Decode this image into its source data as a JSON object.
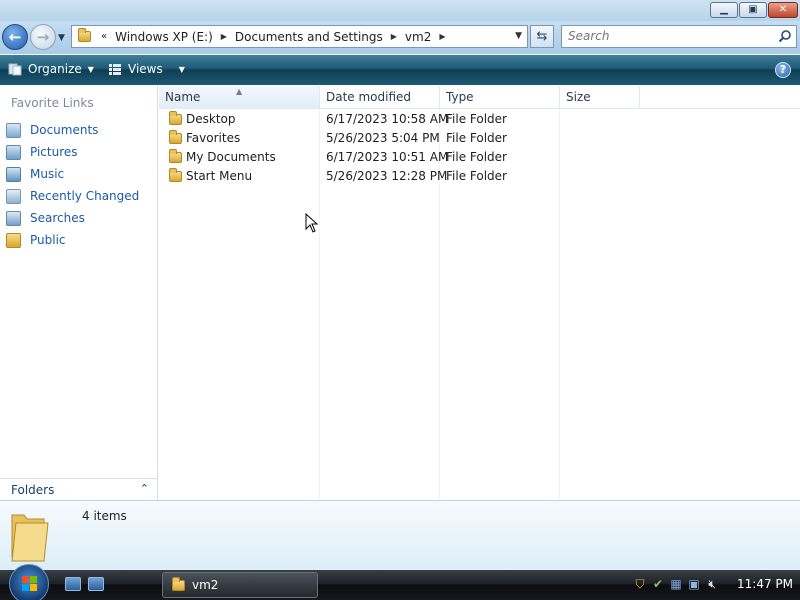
{
  "window": {
    "controls": [
      "minimize",
      "maximize",
      "close"
    ]
  },
  "address": {
    "overflow": "«",
    "crumbs": [
      "Windows XP (E:)",
      "Documents and Settings",
      "vm2"
    ]
  },
  "search": {
    "placeholder": "Search"
  },
  "toolbar": {
    "organize_label": "Organize",
    "views_label": "Views"
  },
  "left_nav": {
    "title": "Favorite Links",
    "items": [
      {
        "label": "Documents",
        "icon": "documents-icon"
      },
      {
        "label": "Pictures",
        "icon": "pictures-icon"
      },
      {
        "label": "Music",
        "icon": "music-icon"
      },
      {
        "label": "Recently Changed",
        "icon": "recently-changed-icon"
      },
      {
        "label": "Searches",
        "icon": "searches-icon"
      },
      {
        "label": "Public",
        "icon": "folder-icon"
      }
    ],
    "folders_label": "Folders"
  },
  "file_list": {
    "columns": [
      "Name",
      "Date modified",
      "Type",
      "Size"
    ],
    "rows": [
      {
        "name": "Desktop",
        "date": "6/17/2023 10:58 AM",
        "type": "File Folder",
        "size": ""
      },
      {
        "name": "Favorites",
        "date": "5/26/2023 5:04 PM",
        "type": "File Folder",
        "size": ""
      },
      {
        "name": "My Documents",
        "date": "6/17/2023 10:51 AM",
        "type": "File Folder",
        "size": ""
      },
      {
        "name": "Start Menu",
        "date": "5/26/2023 12:28 PM",
        "type": "File Folder",
        "size": ""
      }
    ]
  },
  "details": {
    "item_count": "4 items"
  },
  "taskbar": {
    "task_label": "vm2",
    "clock": "11:47 PM"
  },
  "colors": {
    "toolbar": "#1d5a75",
    "link": "#1c5aa7",
    "address_bg": "#b7d4ea"
  }
}
